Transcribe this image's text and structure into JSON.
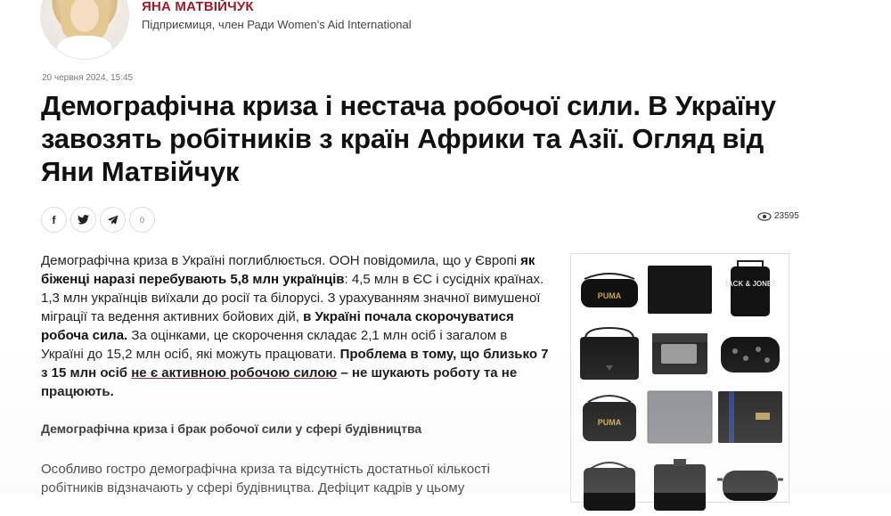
{
  "author": {
    "name": "ЯНА МАТВІЙЧУК",
    "role": "Підприємиця, член Ради Women's Aid International"
  },
  "article": {
    "date": "20 червня 2024, 15:45",
    "title": "Демографічна криза і нестача робочої сили. В Україну завозять робітників з країн Африки та Азії. Огляд від Яни Матвійчук",
    "share": {
      "facebook_label": "f",
      "twitter_icon": "twitter-bird",
      "telegram_icon": "paper-plane",
      "comment_count": "0"
    },
    "views": "23595",
    "para1": {
      "t1": "Демографічна криза в Україні поглиблюється. ООН повідомила, що у Європі ",
      "b1": "як біженці наразі перебувають 5,8 млн українців",
      "t2": ": 4,5 млн в ЄС і сусідніх країнах. 1,3 млн українців виїхали до росії та білорусі. З урахуванням значної вимушеної міграції та ведення активних бойових дій, ",
      "b2": "в Україні почала скорочуватися робоча сила.",
      "t3": " За оцінками, це скорочення складає 2,1 млн осіб і загалом в Україні до 15,2 млн осіб, які можуть працювати. ",
      "b3": "Проблема в тому, що близько 7 з 15 млн осіб ",
      "link": "не є активною робочою силою",
      "b4": " – не шукають роботу та не працюють."
    },
    "subheading": "Демографічна криза і брак робочої сили у сфері будівництва",
    "para2": "Особливо гостро демографічна криза та відсутність достатньої кількості робітників відзначають у сфері будівництва. Дефіцит кадрів у цьому"
  },
  "ad": {
    "products": [
      {
        "name": "puma-black-shoulder-bag",
        "label": "PUMA",
        "color": "#121212"
      },
      {
        "name": "black-wallet",
        "label": "",
        "color": "#1a1a1a"
      },
      {
        "name": "jack-jones-crossbody-bag",
        "label": "JACK & JONES",
        "color": "#151515"
      },
      {
        "name": "black-messenger-bag",
        "label": "",
        "color": "#1c1c1c"
      },
      {
        "name": "leather-card-wallet",
        "label": "",
        "color": "#2a2a2a"
      },
      {
        "name": "patterned-waist-bag",
        "label": "",
        "color": "#161616"
      },
      {
        "name": "puma-black-crossbody",
        "label": "PUMA",
        "color": "#101010"
      },
      {
        "name": "grey-herschel-wallet",
        "label": "",
        "color": "#8a8d91"
      },
      {
        "name": "black-herschel-wallet",
        "label": "",
        "color": "#1d1d1d"
      },
      {
        "name": "black-bag-4",
        "label": "",
        "color": "#141414"
      },
      {
        "name": "black-bag-5",
        "label": "",
        "color": "#141414"
      },
      {
        "name": "black-waist-bag",
        "label": "",
        "color": "#141414"
      }
    ]
  },
  "colors": {
    "accent": "#9b1c2b",
    "text": "#111111"
  }
}
